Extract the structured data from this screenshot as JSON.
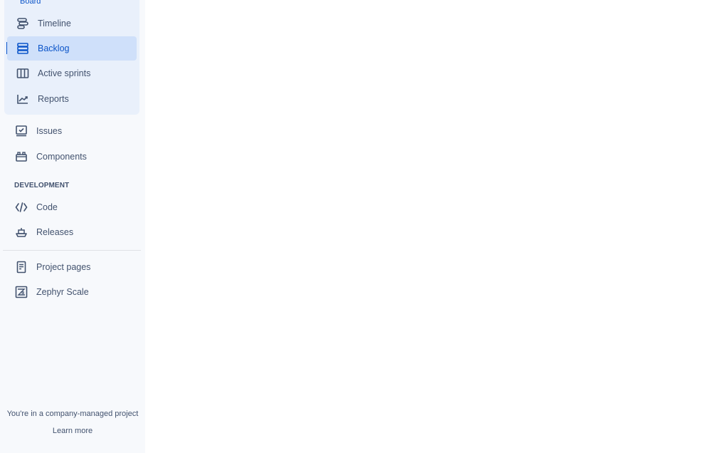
{
  "sidebar": {
    "board_group": {
      "label": "Board",
      "items": [
        {
          "label": "Timeline",
          "icon": "timeline-icon"
        },
        {
          "label": "Backlog",
          "icon": "backlog-icon",
          "active": true
        },
        {
          "label": "Active sprints",
          "icon": "columns-icon"
        },
        {
          "label": "Reports",
          "icon": "chart-line-icon"
        }
      ]
    },
    "items": [
      {
        "label": "Issues",
        "icon": "issues-icon"
      },
      {
        "label": "Components",
        "icon": "components-icon"
      }
    ],
    "development": {
      "heading": "DEVELOPMENT",
      "items": [
        {
          "label": "Code",
          "icon": "code-icon"
        },
        {
          "label": "Releases",
          "icon": "ship-icon"
        }
      ]
    },
    "extra_items": [
      {
        "label": "Project pages",
        "icon": "page-icon"
      },
      {
        "label": "Zephyr Scale",
        "icon": "zephyr-scale-icon"
      }
    ],
    "footer": {
      "text": "You're in a company-managed project",
      "link": "Learn more"
    }
  },
  "colors": {
    "accent": "#0c55c9",
    "sidebar_bg": "#f7f9fc",
    "board_group_bg": "#e9f0fb",
    "active_bg": "#cfe0fa",
    "text": "#42526e"
  }
}
